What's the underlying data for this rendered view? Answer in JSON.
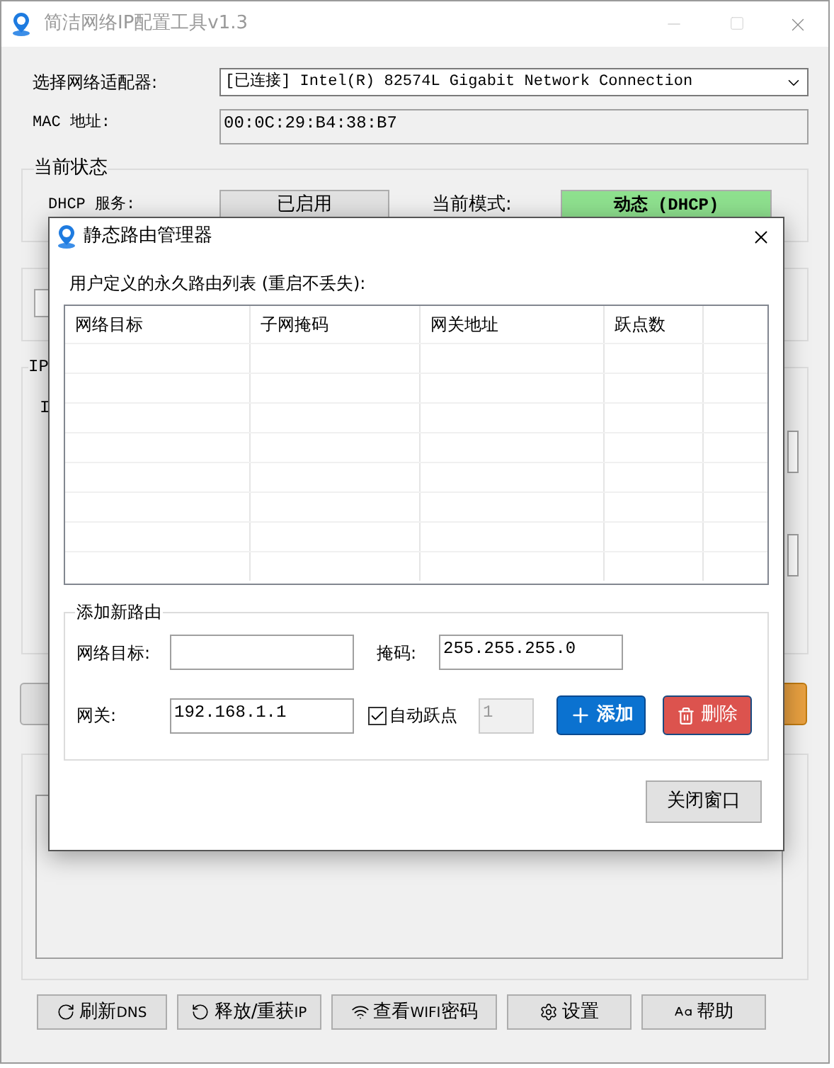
{
  "window": {
    "title": "简洁网络IP配置工具v1.3"
  },
  "adapter": {
    "label": "选择网络适配器:",
    "value": "[已连接] Intel(R) 82574L Gigabit Network Connection"
  },
  "mac": {
    "label": "MAC 地址:",
    "value": "00:0C:29:B4:38:B7"
  },
  "status": {
    "title": "当前状态",
    "dhcp_label": "DHCP 服务:",
    "dhcp_value": "已启用",
    "mode_label": "当前模式:",
    "mode_value": "动态 (DHCP)"
  },
  "ip_group": {
    "title": "IP",
    "labels": [
      "I"
    ]
  },
  "toolbar": [
    {
      "kind": "refresh",
      "label": "刷新",
      "suffix": "DNS"
    },
    {
      "kind": "release",
      "label": "释放/重获",
      "suffix": "IP"
    },
    {
      "kind": "wifi",
      "label": "查看",
      "suffix": "WIFI",
      "tail": "密码"
    },
    {
      "kind": "settings",
      "label": "设置"
    },
    {
      "kind": "help",
      "label": "帮助"
    }
  ],
  "dialog": {
    "title": "静态路由管理器",
    "list_label": "用户定义的永久路由列表 (重启不丢失):",
    "columns": [
      "网络目标",
      "子网掩码",
      "网关地址",
      "跃点数"
    ],
    "add_group": {
      "title": "添加新路由",
      "destination": {
        "label": "网络目标:"
      },
      "mask": {
        "label": "掩码:",
        "value": "255.255.255.0"
      },
      "gateway": {
        "label": "网关:",
        "value": "192.168.1.1"
      },
      "auto_metric": {
        "label": "自动跃点",
        "checked": true
      },
      "metric": {
        "value": "1",
        "disabled": true
      },
      "add_button": "添加",
      "delete_button": "删除"
    },
    "close_button": "关闭窗口"
  }
}
